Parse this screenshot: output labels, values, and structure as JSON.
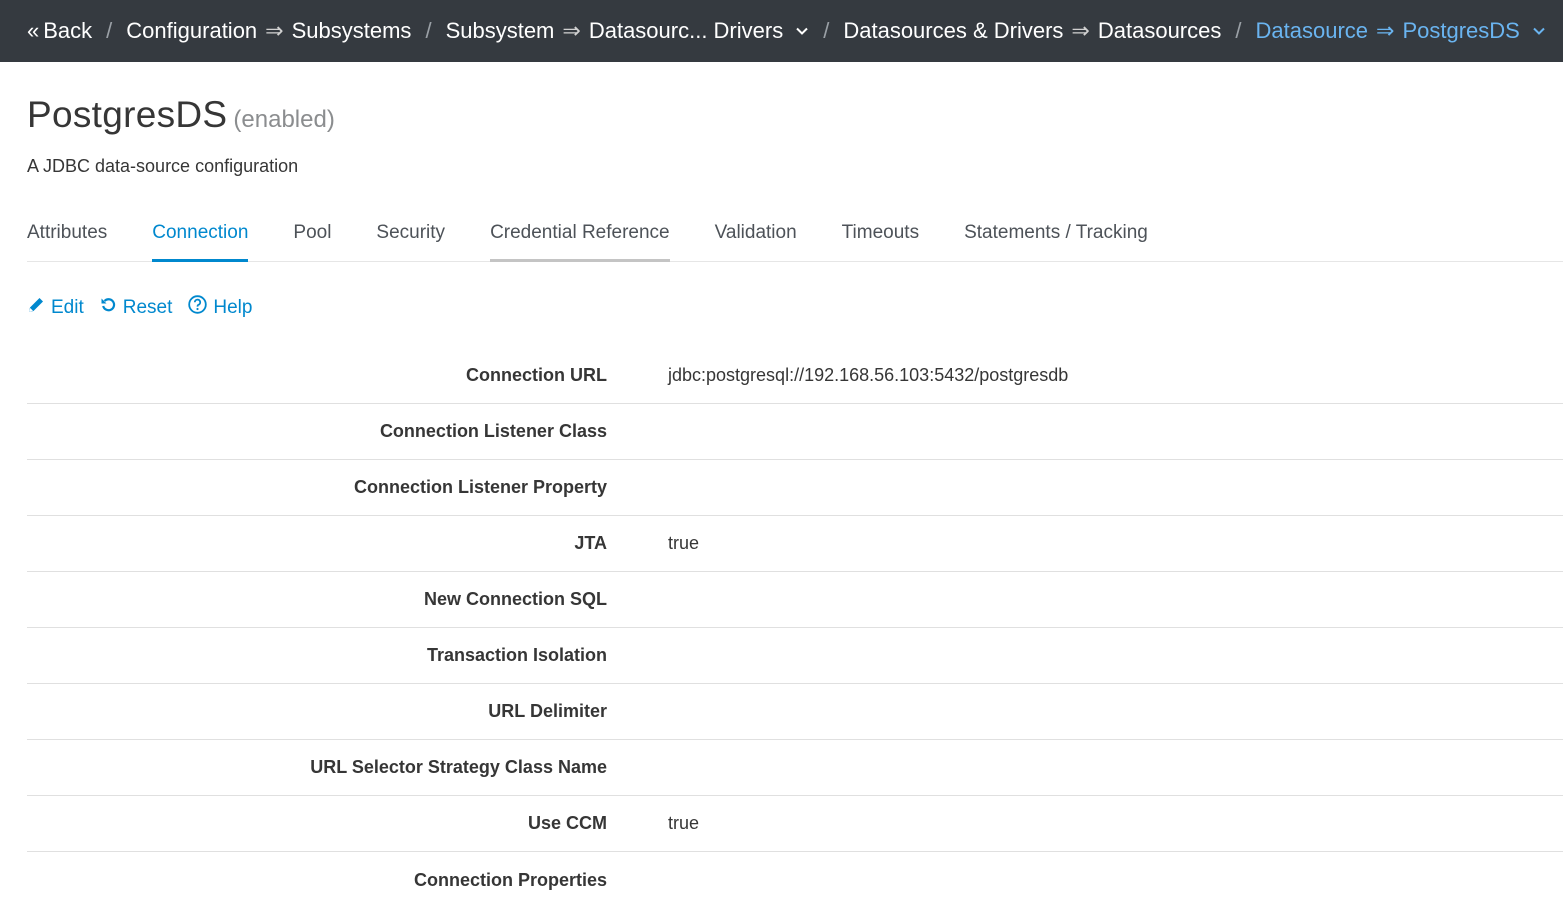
{
  "breadcrumb": {
    "back_label": "Back",
    "items": [
      {
        "left": "Configuration",
        "right": "Subsystems",
        "dropdown": false
      },
      {
        "left": "Subsystem",
        "right": "Datasourc... Drivers",
        "dropdown": true
      },
      {
        "left": "Datasources & Drivers",
        "right": "Datasources",
        "dropdown": false
      },
      {
        "left": "Datasource",
        "right": "PostgresDS",
        "dropdown": true
      }
    ],
    "separator": "/",
    "arrow": "⇒"
  },
  "page": {
    "title": "PostgresDS",
    "status": "(enabled)",
    "description": "A JDBC data-source configuration"
  },
  "tabs": [
    {
      "label": "Attributes"
    },
    {
      "label": "Connection"
    },
    {
      "label": "Pool"
    },
    {
      "label": "Security"
    },
    {
      "label": "Credential Reference"
    },
    {
      "label": "Validation"
    },
    {
      "label": "Timeouts"
    },
    {
      "label": "Statements / Tracking"
    }
  ],
  "active_tab": "Connection",
  "actions": {
    "edit": "Edit",
    "reset": "Reset",
    "help": "Help"
  },
  "properties": [
    {
      "label": "Connection URL",
      "value": "jdbc:postgresql://192.168.56.103:5432/postgresdb"
    },
    {
      "label": "Connection Listener Class",
      "value": ""
    },
    {
      "label": "Connection Listener Property",
      "value": ""
    },
    {
      "label": "JTA",
      "value": "true"
    },
    {
      "label": "New Connection SQL",
      "value": ""
    },
    {
      "label": "Transaction Isolation",
      "value": ""
    },
    {
      "label": "URL Delimiter",
      "value": ""
    },
    {
      "label": "URL Selector Strategy Class Name",
      "value": ""
    },
    {
      "label": "Use CCM",
      "value": "true"
    },
    {
      "label": "Connection Properties",
      "value": ""
    }
  ],
  "colors": {
    "topbar": "#353a40",
    "accent": "#0088ce",
    "active_breadcrumb": "#6ab4f0"
  }
}
